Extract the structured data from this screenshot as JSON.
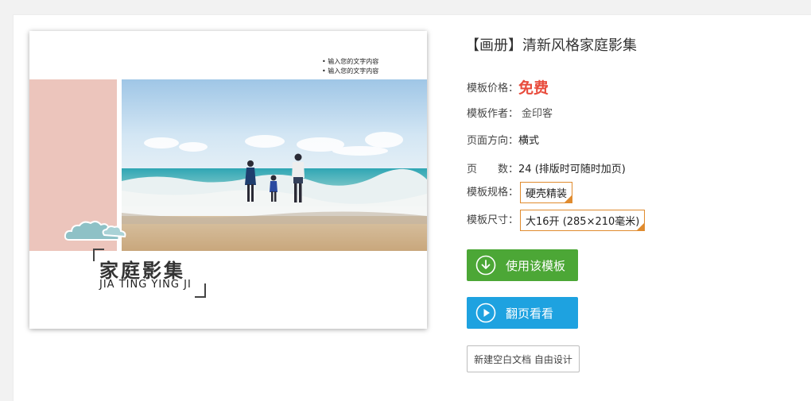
{
  "preview": {
    "tagline": [
      "输入您的文字内容",
      "输入您的文字内容"
    ],
    "album_title": "家庭影集",
    "album_subtitle": "JIA TING YING JI"
  },
  "product": {
    "title": "【画册】清新风格家庭影集",
    "price_label": "模板价格：",
    "price_value": "免费",
    "author_label": "模板作者：",
    "author_value": "金印客",
    "orientation_label": "页面方向：",
    "orientation_value": "横式",
    "pages_label": "页　　数：",
    "pages_value": "24 (排版时可随时加页)",
    "spec_label": "模板规格：",
    "spec_value": "硬壳精装",
    "size_label": "模板尺寸：",
    "size_value": "大16开 (285×210毫米)"
  },
  "actions": {
    "use_template": "使用该模板",
    "flip_preview": "翻页看看",
    "new_blank": "新建空白文档 自由设计"
  },
  "icons": {
    "use_template": "download-circle-icon",
    "flip_preview": "play-circle-icon",
    "spec_dropdown": "dropdown-corner-icon"
  },
  "colors": {
    "accent_price": "#e84c3d",
    "green_button": "#4ca736",
    "blue_button": "#1ea2e0",
    "dropdown_border": "#e08b2e",
    "pink_block": "#ecc5bc"
  }
}
